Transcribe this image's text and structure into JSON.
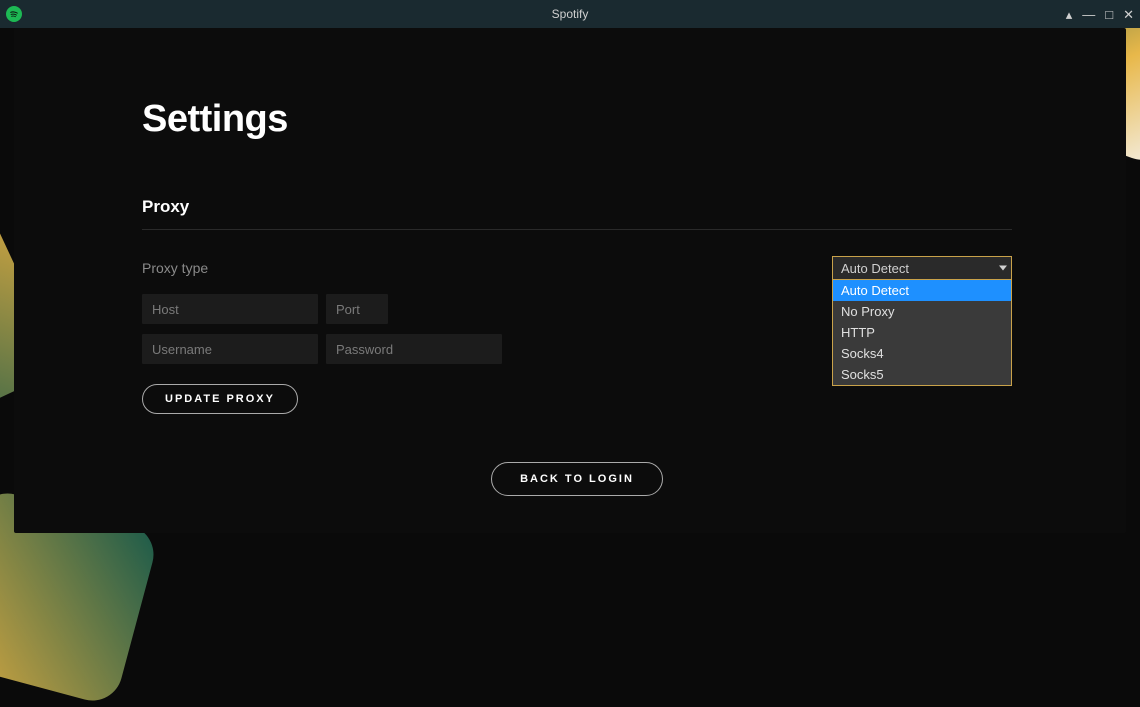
{
  "window": {
    "title": "Spotify"
  },
  "page": {
    "title": "Settings"
  },
  "proxy": {
    "section_title": "Proxy",
    "type_label": "Proxy type",
    "selected": "Auto Detect",
    "options": [
      "Auto Detect",
      "No Proxy",
      "HTTP",
      "Socks4",
      "Socks5"
    ],
    "host_placeholder": "Host",
    "port_placeholder": "Port",
    "username_placeholder": "Username",
    "password_placeholder": "Password",
    "host_value": "",
    "port_value": "",
    "username_value": "",
    "password_value": "",
    "update_label": "UPDATE PROXY"
  },
  "back_label": "BACK TO LOGIN",
  "colors": {
    "accent": "#1db954",
    "dropdown_border": "#c9a24a",
    "highlight": "#1e90ff"
  }
}
